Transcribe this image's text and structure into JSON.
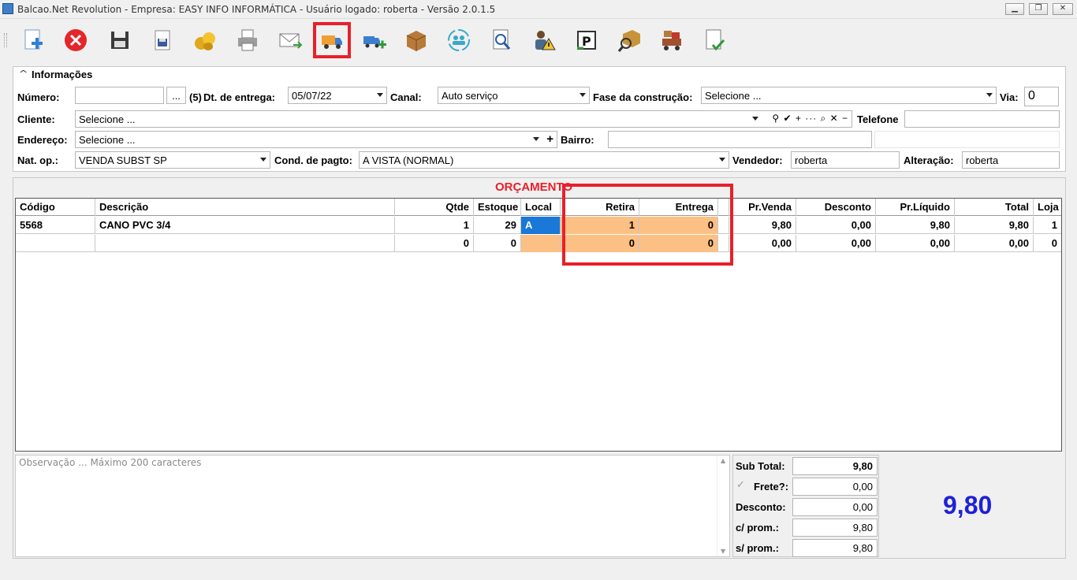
{
  "window": {
    "title": "Balcao.Net Revolution - Empresa: EASY INFO INFORMÁTICA - Usuário logado: roberta - Versão 2.0.1.5",
    "min": "▁",
    "max": "❐",
    "close": "✕"
  },
  "toolbar": {
    "icons": [
      "new-doc-icon",
      "cancel-icon",
      "save-icon",
      "save-as-icon",
      "coins-icon",
      "print-icon",
      "email-icon",
      "truck-icon",
      "truck-add-icon",
      "box-icon",
      "users-sync-icon",
      "search-doc-icon",
      "user-warning-icon",
      "report-icon",
      "box-search-icon",
      "delivery-cart-icon",
      "doc-check-icon"
    ]
  },
  "info": {
    "section_title": "Informações",
    "collapse_glyph": "^",
    "numero_label": "Número:",
    "numero_value": "",
    "ellipsis_button": "...",
    "count": "(5)",
    "dt_entrega_label": "Dt. de entrega:",
    "dt_entrega_value": "05/07/22",
    "canal_label": "Canal:",
    "canal_value": "Auto serviço",
    "fase_label": "Fase da construção:",
    "fase_value": "Selecione ...",
    "via_label": "Via:",
    "via_value": "0",
    "cliente_label": "Cliente:",
    "cliente_value": "Selecione ...",
    "cliente_tools": "⚲ ✔ + ··· ⌕ ✕ −",
    "telefone_label": "Telefone",
    "telefone_value": "",
    "endereco_label": "Endereço:",
    "endereco_value": "Selecione ...",
    "endereco_add": "+",
    "bairro_label": "Bairro:",
    "bairro_value": "",
    "natop_label": "Nat. op.:",
    "natop_value": "VENDA SUBST SP",
    "condpagto_label": "Cond. de pagto:",
    "condpagto_value": "A VISTA (NORMAL)",
    "vendedor_label": "Vendedor:",
    "vendedor_value": "roberta",
    "alteracao_label": "Alteração:",
    "alteracao_value": "roberta"
  },
  "grid": {
    "title": "ORÇAMENTO",
    "headers": {
      "codigo": "Código",
      "descricao": "Descrição",
      "qtde": "Qtde",
      "estoque": "Estoque",
      "local": "Local",
      "retira": "Retira",
      "entrega": "Entrega",
      "prvenda": "Pr.Venda",
      "desconto": "Desconto",
      "prliquido": "Pr.Líquido",
      "total": "Total",
      "loja": "Loja"
    },
    "rows": [
      {
        "codigo": "5568",
        "descricao": "CANO PVC 3/4",
        "qtde": "1",
        "estoque": "29",
        "local": "A",
        "retira": "1",
        "entrega": "0",
        "prvenda": "9,80",
        "desconto": "0,00",
        "prliquido": "9,80",
        "total": "9,80",
        "loja": "1"
      },
      {
        "codigo": "",
        "descricao": "",
        "qtde": "0",
        "estoque": "0",
        "local": "",
        "retira": "0",
        "entrega": "0",
        "prvenda": "0,00",
        "desconto": "0,00",
        "prliquido": "0,00",
        "total": "0,00",
        "loja": "0"
      }
    ]
  },
  "obs": {
    "placeholder": "Observação ... Máximo 200 caracteres"
  },
  "totals": {
    "subtotal_label": "Sub Total:",
    "subtotal_value": "9,80",
    "frete_label": "Frete?:",
    "frete_value": "0,00",
    "frete_check": "✓",
    "desconto_label": "Desconto:",
    "desconto_value": "0,00",
    "cprom_label": "c/ prom.:",
    "cprom_value": "9,80",
    "sprom_label": "s/ prom.:",
    "sprom_value": "9,80",
    "big_total": "9,80"
  },
  "colors": {
    "accent_red": "#e8202a",
    "orange": "#fcc084",
    "blue_total": "#1f20d8",
    "local_blue": "#1a78d8"
  }
}
